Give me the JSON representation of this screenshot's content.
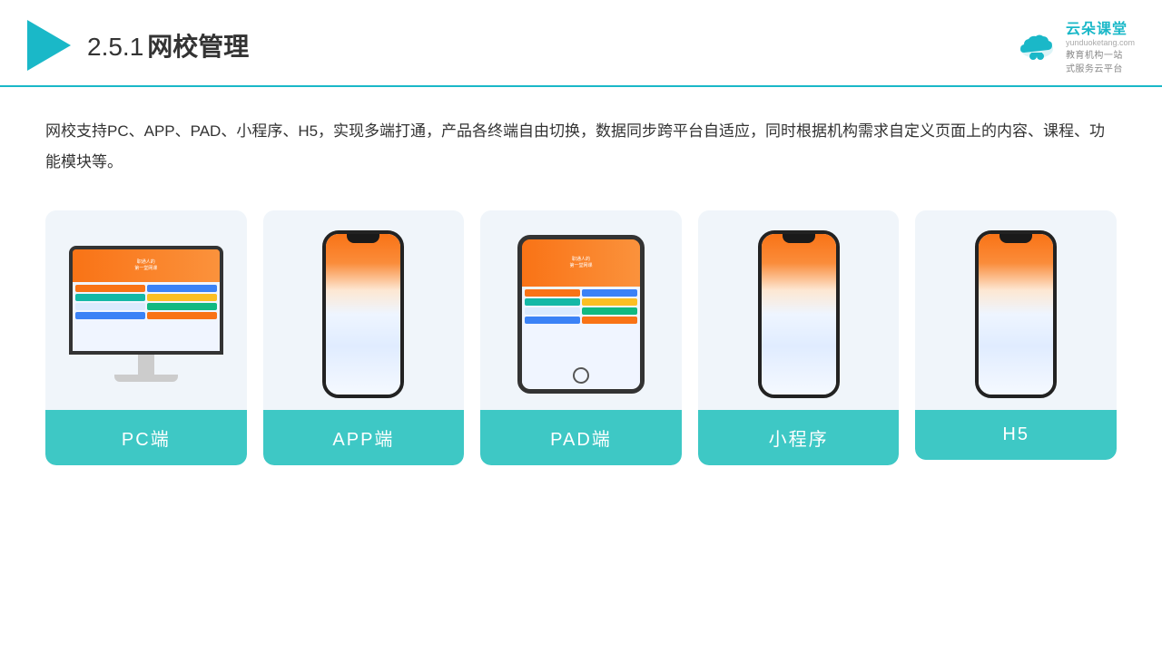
{
  "header": {
    "section_num": "2.5.1",
    "title": "网校管理",
    "brand_main": "云朵课堂",
    "brand_url": "yunduoketang.com",
    "brand_tagline": "教育机构一站",
    "brand_tagline2": "式服务云平台"
  },
  "description": {
    "text": "网校支持PC、APP、PAD、小程序、H5，实现多端打通，产品各终端自由切换，数据同步跨平台自适应，同时根据机构需求自定义页面上的内容、课程、功能模块等。"
  },
  "cards": [
    {
      "id": "pc",
      "label": "PC端"
    },
    {
      "id": "app",
      "label": "APP端"
    },
    {
      "id": "pad",
      "label": "PAD端"
    },
    {
      "id": "mini",
      "label": "小程序"
    },
    {
      "id": "h5",
      "label": "H5"
    }
  ]
}
